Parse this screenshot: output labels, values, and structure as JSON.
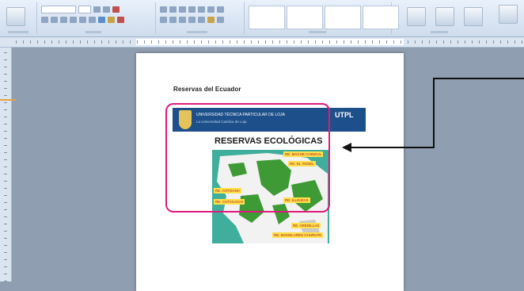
{
  "ribbon": {
    "groups": [
      "clipboard",
      "font",
      "paragraph",
      "styles",
      "editing"
    ],
    "style_boxes": 4
  },
  "document": {
    "heading": "Reservas del Ecuador",
    "banner": {
      "university_name": "UNIVERSIDAD TÉCNICA PARTICULAR DE LOJA",
      "tagline": "La Universidad Católica de Loja",
      "logo_text": "UTPL"
    },
    "image_title": "RESERVAS ECOLÓGICAS",
    "map_tags": [
      "RE. MACHE CHINDUL",
      "RE. EL ÁNGEL",
      "RE. ANTISANA",
      "RE. COTACACHI",
      "RE. ILLINIZAS",
      "RE. ARENILLAS",
      "RE. MANGLARES CHURUTE"
    ]
  },
  "annotation": {
    "highlight_color": "#e0197d",
    "arrow_color": "#111111"
  },
  "colors": {
    "workspace": "#8f9eb0",
    "ribbon": "#dbe5f1",
    "banner": "#1d4f8a",
    "map_sea": "#3fae9c",
    "tag_bg": "#ffe14a",
    "tag_text": "#b01020"
  }
}
